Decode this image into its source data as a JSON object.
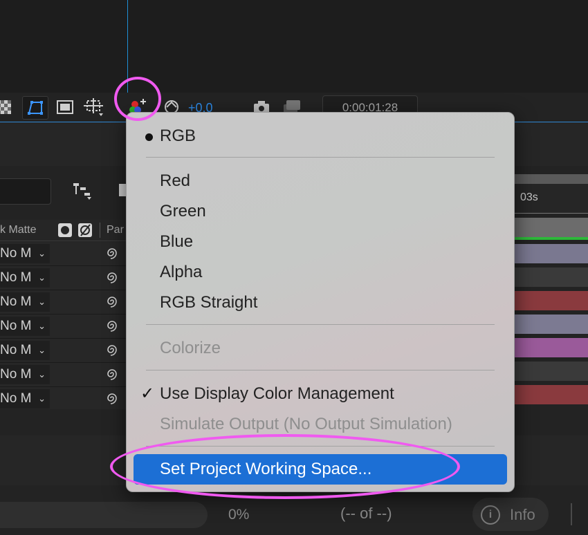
{
  "viewer": {
    "exposure_value": "+0.0",
    "timecode": "0:00:01:28"
  },
  "timeline": {
    "ruler_label": "03s",
    "col_track_matte": "k Matte",
    "col_parent": "Par",
    "rows": [
      {
        "matte": "No M",
        "bar_color": "#7a7890"
      },
      {
        "matte": "No M",
        "bar_color": "#3a3a3a"
      },
      {
        "matte": "No M",
        "bar_color": "#8a3a3e"
      },
      {
        "matte": "No M",
        "bar_color": "#7c7a92"
      },
      {
        "matte": "No M",
        "bar_color": "#9a5a9a"
      },
      {
        "matte": "No M",
        "bar_color": "#3a3a3a"
      },
      {
        "matte": "No M",
        "bar_color": "#8a3a3e"
      }
    ]
  },
  "status": {
    "percent": "0%",
    "counter": "(-- of --)",
    "info_label": "Info"
  },
  "menu": {
    "rgb": "RGB",
    "red": "Red",
    "green": "Green",
    "blue": "Blue",
    "alpha": "Alpha",
    "rgb_straight": "RGB Straight",
    "colorize": "Colorize",
    "use_display_cm": "Use Display Color Management",
    "simulate_output": "Simulate Output (No Output Simulation)",
    "set_project_ws": "Set Project Working Space..."
  },
  "colors": {
    "highlight": "#1c6fd5",
    "annotation": "#f05af0",
    "accent": "#2d8ceb"
  }
}
